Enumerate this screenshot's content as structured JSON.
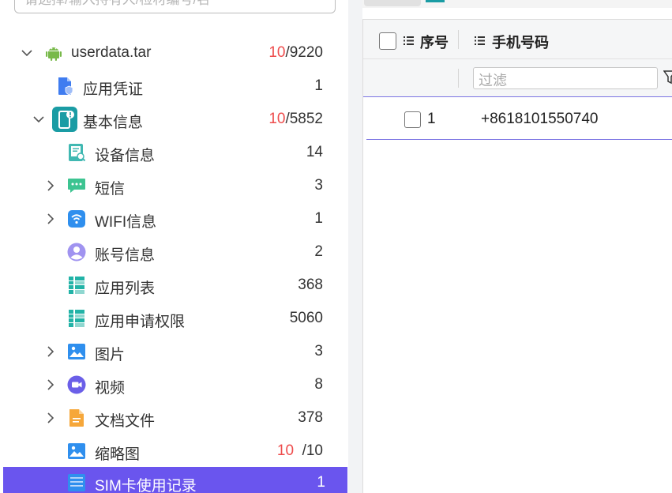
{
  "search": {
    "placeholder": "请选择/输入持有人/检材编号/名"
  },
  "tree": [
    {
      "label": "userdata.tar",
      "count_highlight": "10",
      "count_rest": "/9220",
      "icon": "android-icon",
      "chevron": "down",
      "level": 0
    },
    {
      "label": "应用凭证",
      "count": "1",
      "icon": "credential-icon",
      "level": 1
    },
    {
      "label": "基本信息",
      "count_highlight": "10",
      "count_rest": "/5852",
      "icon": "phone-info-icon",
      "chevron": "down",
      "level": 1
    },
    {
      "label": "设备信息",
      "count": "14",
      "icon": "device-icon",
      "level": 2
    },
    {
      "label": "短信",
      "count": "3",
      "icon": "sms-icon",
      "chevron": "right",
      "level": 2
    },
    {
      "label": "WIFI信息",
      "count": "1",
      "icon": "wifi-icon",
      "chevron": "right",
      "level": 2
    },
    {
      "label": "账号信息",
      "count": "2",
      "icon": "account-icon",
      "level": 2
    },
    {
      "label": "应用列表",
      "count": "368",
      "icon": "app-list-icon",
      "level": 2
    },
    {
      "label": "应用申请权限",
      "count": "5060",
      "icon": "app-permission-icon",
      "level": 2
    },
    {
      "label": "图片",
      "count": "3",
      "icon": "image-icon",
      "chevron": "right",
      "level": 2
    },
    {
      "label": "视频",
      "count": "8",
      "icon": "video-icon",
      "chevron": "right",
      "level": 2
    },
    {
      "label": "文档文件",
      "count": "378",
      "icon": "document-icon",
      "chevron": "right",
      "level": 2
    },
    {
      "label": "缩略图",
      "count_highlight": "10",
      "count_rest": "/10",
      "icon": "thumbnail-icon",
      "level": 2
    },
    {
      "label": "SIM卡使用记录",
      "count": "1",
      "icon": "sim-icon",
      "level": 2,
      "selected": true
    }
  ],
  "table": {
    "columns": [
      {
        "label": "序号"
      },
      {
        "label": "手机号码"
      }
    ],
    "filter_placeholder": "过滤",
    "rows": [
      {
        "index": "1",
        "phone": "+8618101550740"
      }
    ]
  },
  "colors": {
    "selected_bg": "#6a55ee",
    "highlight_count": "#ee4d4d",
    "row_border": "#7b74e3",
    "accent_teal": "#1a9ca4"
  }
}
